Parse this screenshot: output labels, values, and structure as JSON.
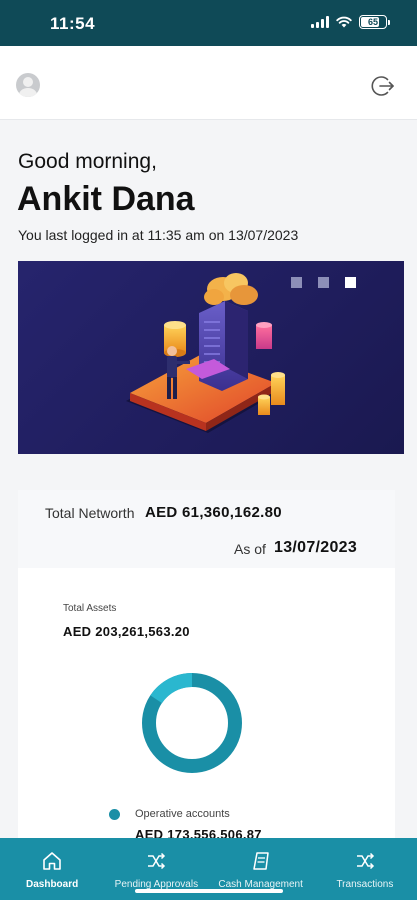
{
  "status_bar": {
    "time": "11:54",
    "battery": "65"
  },
  "header": {
    "avatar_icon": "user-avatar-icon",
    "logout_icon": "logout-power-icon"
  },
  "greeting": "Good morning,",
  "user_name": "Ankit Dana",
  "last_login": "You last logged in at 11:35 am on 13/07/2023",
  "banner": {
    "slides": 3,
    "active_slide": 3
  },
  "networth": {
    "label": "Total Networth",
    "value": "AED 61,360,162.80",
    "as_of_label": "As of",
    "as_of_date": "13/07/2023"
  },
  "assets": {
    "label": "Total Assets",
    "value": "AED 203,261,563.20",
    "legend": [
      {
        "label": "Operative accounts",
        "value": "AED 173,556,506.87",
        "color": "#1a8fa6"
      }
    ],
    "donut_colors": [
      "#1a8fa6",
      "#2ab7cf"
    ]
  },
  "bottom_nav": {
    "items": [
      {
        "label": "Dashboard",
        "icon": "home-icon"
      },
      {
        "label": "Pending Approvals",
        "icon": "shuffle-icon"
      },
      {
        "label": "Cash Management",
        "icon": "document-icon"
      },
      {
        "label": "Transactions",
        "icon": "shuffle-icon"
      }
    ],
    "active_index": 0
  },
  "colors": {
    "primary": "#1a8fa6",
    "status_bar": "#0f4a57"
  }
}
